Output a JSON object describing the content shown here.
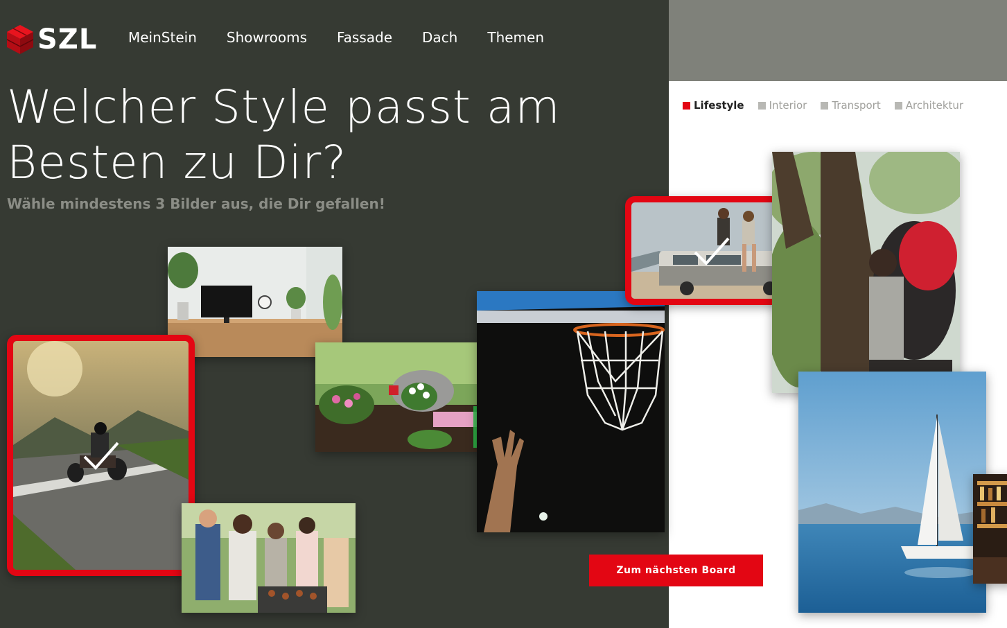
{
  "brand": {
    "logo_text": "SZL"
  },
  "nav": {
    "items": [
      {
        "label": "MeinStein"
      },
      {
        "label": "Showrooms"
      },
      {
        "label": "Fassade"
      },
      {
        "label": "Dach"
      },
      {
        "label": "Themen"
      }
    ]
  },
  "hero": {
    "headline": "Welcher Style passt am Besten zu Dir?",
    "subline": "Wähle mindestens 3 Bilder aus, die Dir gefallen!"
  },
  "category_tabs": [
    {
      "label": "Lifestyle",
      "active": true
    },
    {
      "label": "Interior",
      "active": false
    },
    {
      "label": "Transport",
      "active": false
    },
    {
      "label": "Architektur",
      "active": false
    }
  ],
  "tiles": [
    {
      "subject": "home-office-desk",
      "selected": false
    },
    {
      "subject": "motorcycle-on-road",
      "selected": true
    },
    {
      "subject": "gardening-flowers",
      "selected": false
    },
    {
      "subject": "basketball-hoop",
      "selected": false
    },
    {
      "subject": "friends-on-van-roof",
      "selected": true
    },
    {
      "subject": "backpacker-in-forest",
      "selected": false
    },
    {
      "subject": "friends-barbecue",
      "selected": false
    },
    {
      "subject": "sailboat-on-lake",
      "selected": false
    },
    {
      "subject": "bar-interior",
      "selected": false
    }
  ],
  "actions": {
    "next_board_label": "Zum nächsten Board"
  },
  "colors": {
    "accent": "#e30613",
    "panel_dark": "#363a33",
    "band_grey": "#7f817a",
    "muted_text": "#8b8d86"
  }
}
